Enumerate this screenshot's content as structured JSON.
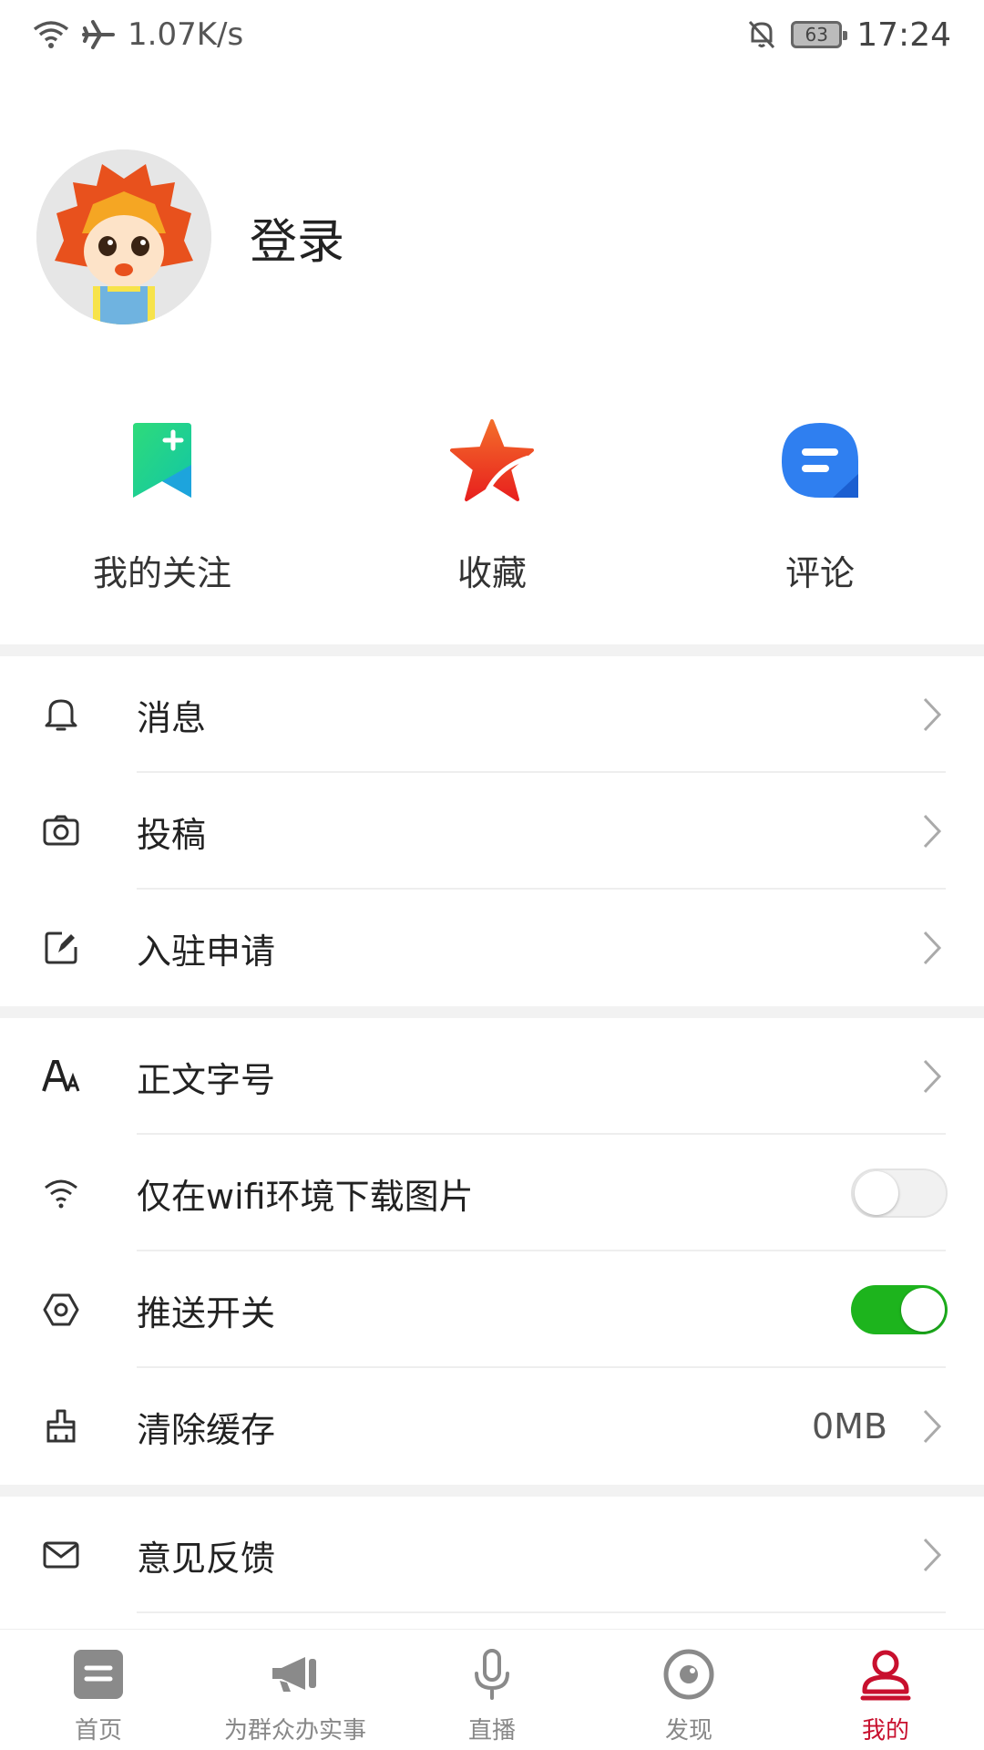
{
  "status_bar": {
    "network_speed": "1.07K/s",
    "battery": "63",
    "time": "17:24"
  },
  "profile": {
    "login_label": "登录"
  },
  "quick_actions": [
    {
      "label": "我的关注",
      "icon": "bookmark-add-icon",
      "color": "#1ed27a"
    },
    {
      "label": "收藏",
      "icon": "star-icon",
      "color": "#f05a28"
    },
    {
      "label": "评论",
      "icon": "comment-icon",
      "color": "#2f7ff0"
    }
  ],
  "menu": {
    "group1": [
      {
        "label": "消息",
        "icon": "bell-icon"
      },
      {
        "label": "投稿",
        "icon": "camera-icon"
      },
      {
        "label": "入驻申请",
        "icon": "edit-icon"
      }
    ],
    "group2": [
      {
        "label": "正文字号",
        "icon": "font-size-icon"
      },
      {
        "label": "仅在wifi环境下载图片",
        "icon": "wifi-icon",
        "toggle": false
      },
      {
        "label": "推送开关",
        "icon": "hexagon-icon",
        "toggle": true
      },
      {
        "label": "清除缓存",
        "icon": "broom-icon",
        "value": "0MB"
      }
    ],
    "group3": [
      {
        "label": "意见反馈",
        "icon": "mail-icon"
      }
    ]
  },
  "bottom_nav": [
    {
      "label": "首页",
      "icon": "home-icon"
    },
    {
      "label": "为群众办实事",
      "icon": "megaphone-icon"
    },
    {
      "label": "直播",
      "icon": "microphone-icon"
    },
    {
      "label": "发现",
      "icon": "discover-icon"
    },
    {
      "label": "我的",
      "icon": "profile-icon",
      "active": true
    }
  ],
  "colors": {
    "accent_red": "#c8102e",
    "toggle_on": "#1db41d"
  }
}
